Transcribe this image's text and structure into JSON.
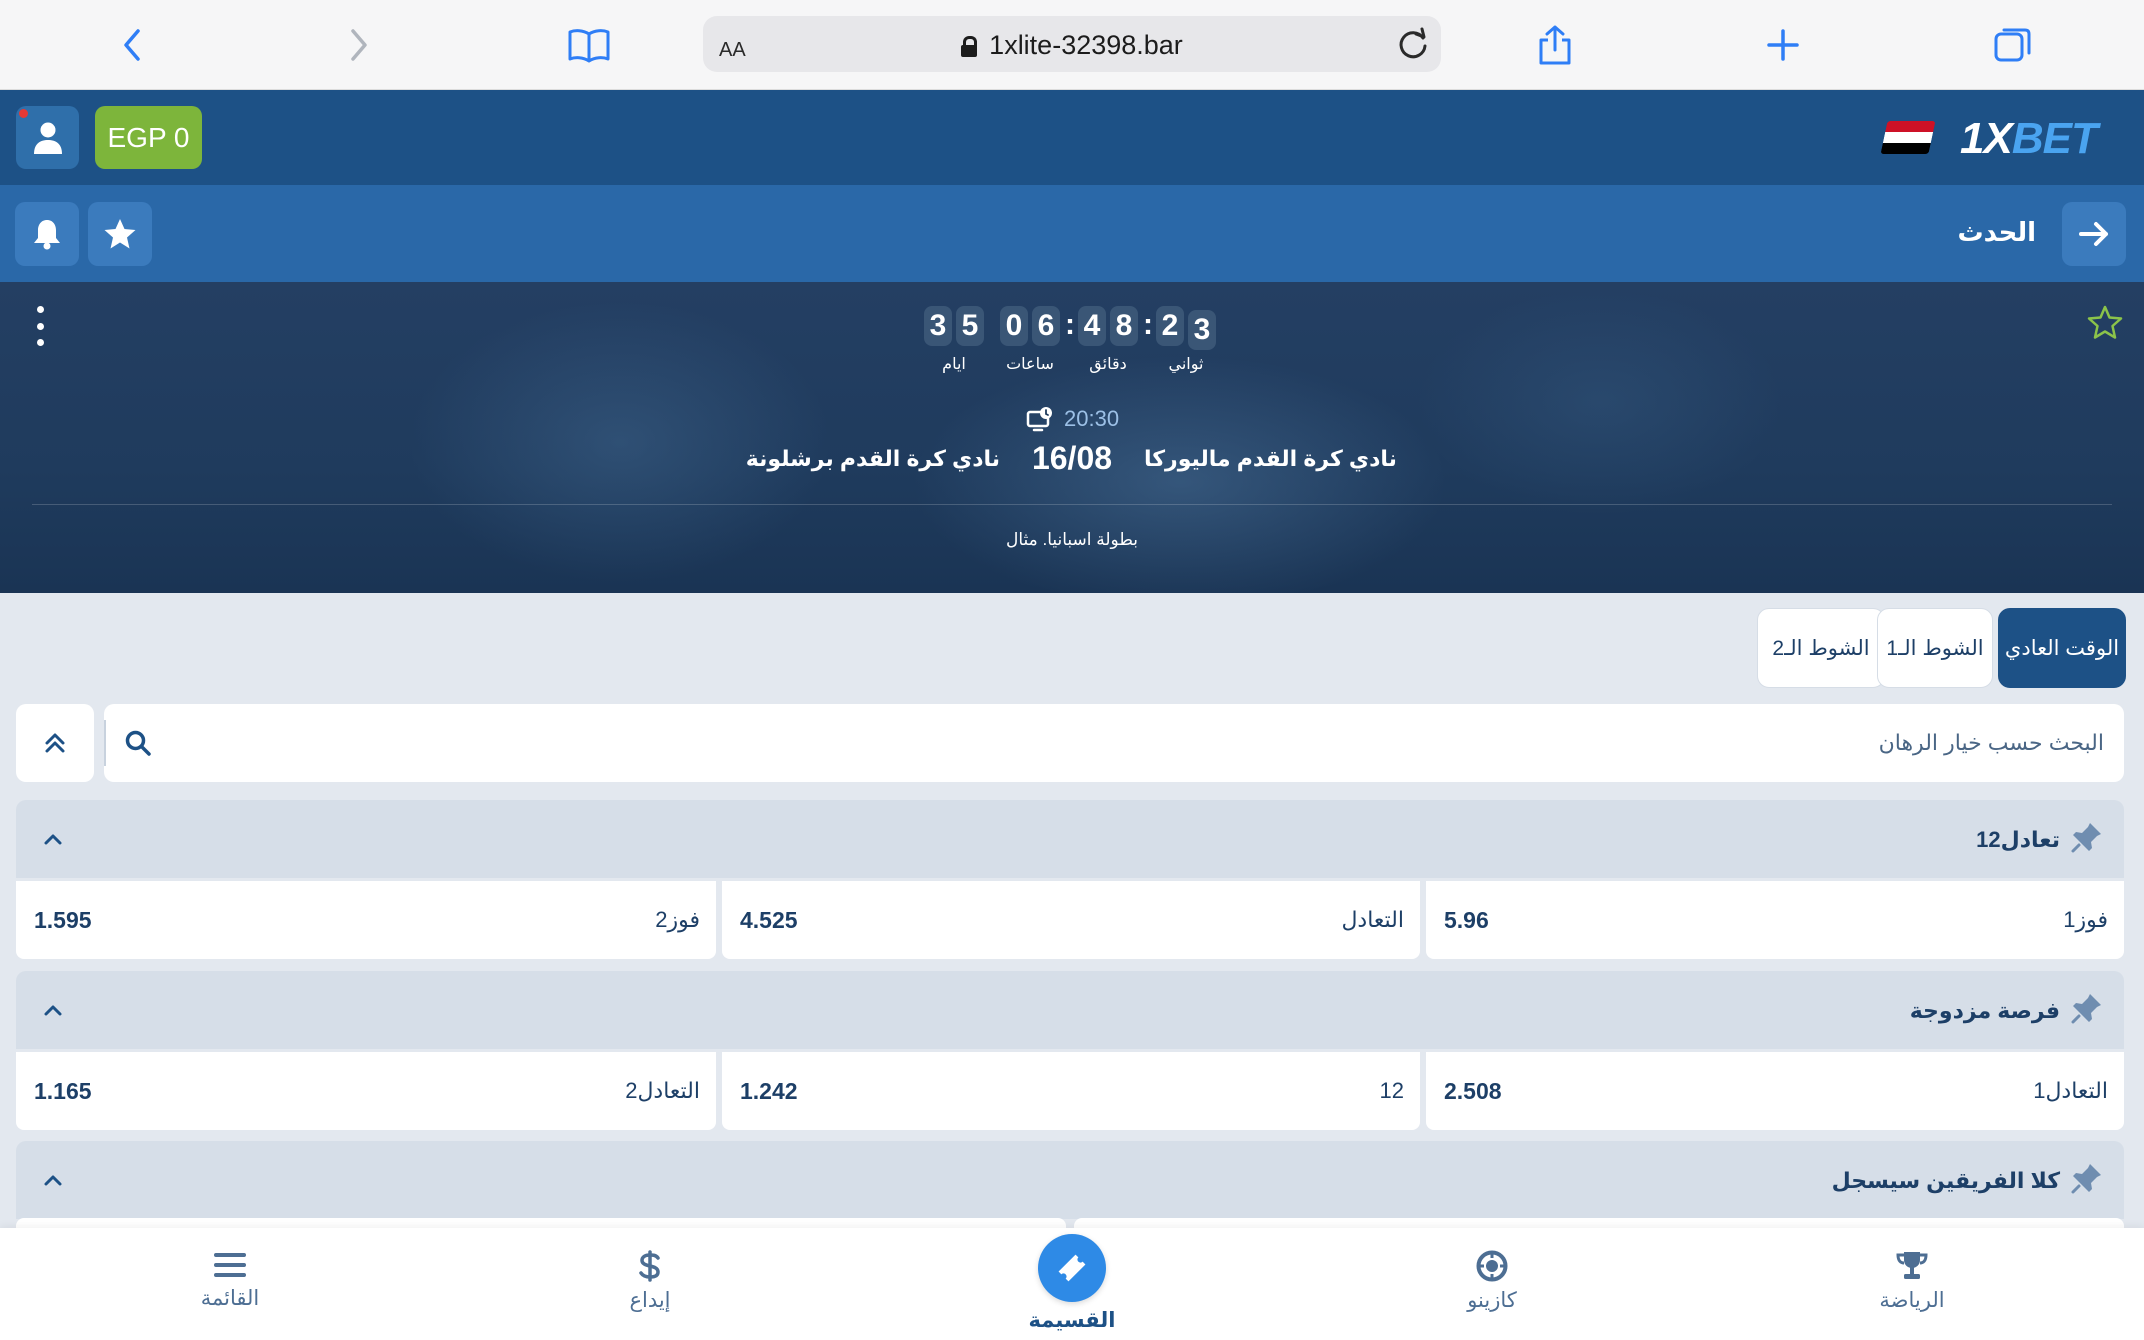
{
  "browser": {
    "text_size_label": "AA",
    "url": "1xlite-32398.bar"
  },
  "header": {
    "balance": "EGP 0",
    "logo_prefix": "1X",
    "logo_suffix": "BET"
  },
  "nav": {
    "title": "الحدث"
  },
  "event": {
    "countdown": {
      "days": [
        "3",
        "5"
      ],
      "hours": [
        "0",
        "6"
      ],
      "minutes": [
        "4",
        "8"
      ],
      "seconds": [
        "2",
        "3"
      ],
      "days_label": "ايام",
      "hours_label": "ساعات",
      "minutes_label": "دقائق",
      "seconds_label": "ثواني"
    },
    "time": "20:30",
    "date": "16/08",
    "home_team": "نادي كرة القدم ماليوركا",
    "away_team": "نادي كرة القدم برشلونة",
    "league": "بطولة اسبانيا. مثال"
  },
  "tabs": [
    {
      "label": "الوقت العادي",
      "active": true
    },
    {
      "label": "الشوط الـ1",
      "active": false
    },
    {
      "label": "الشوط الـ2",
      "active": false
    }
  ],
  "search": {
    "placeholder": "البحث حسب خيار الرهان"
  },
  "markets": [
    {
      "title": "1تعادل2",
      "odds": [
        {
          "label": "فوز1",
          "value": "5.96"
        },
        {
          "label": "التعادل",
          "value": "4.525"
        },
        {
          "label": "فوز2",
          "value": "1.595"
        }
      ]
    },
    {
      "title": "فرصة مزدوجة",
      "odds": [
        {
          "label": "1التعادل",
          "value": "2.508"
        },
        {
          "label": "12",
          "value": "1.242"
        },
        {
          "label": "2التعادل",
          "value": "1.165"
        }
      ]
    },
    {
      "title": "كلا الفريقين سيسجل"
    }
  ],
  "bottom_nav": {
    "sports": "الرياضة",
    "casino": "كازينو",
    "betslip": "القسيمة",
    "deposit": "إيداع",
    "menu": "القائمة"
  },
  "colors": {
    "header_bg": "#1d5186",
    "nav_bg": "#2a68a8",
    "balance_green": "#7db53b",
    "accent_blue": "#2e8ae6",
    "page_bg": "#e3e8ef"
  }
}
